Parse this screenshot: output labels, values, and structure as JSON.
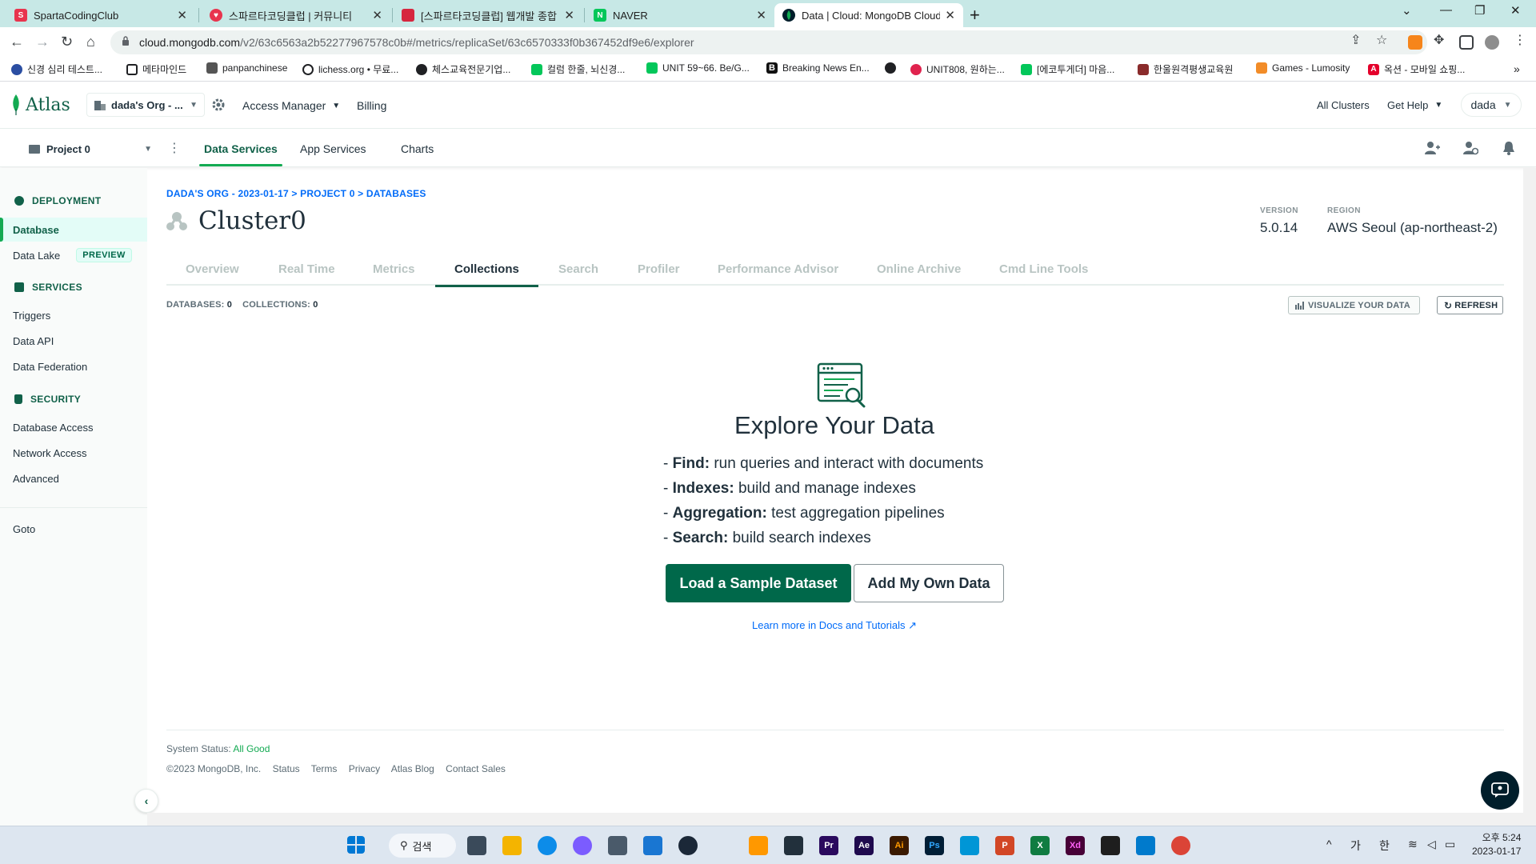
{
  "browser": {
    "tabs": [
      {
        "title": "SpartaCodingClub",
        "active": false
      },
      {
        "title": "스파르타코딩클럽 | 커뮤니티",
        "active": false
      },
      {
        "title": "[스파르타코딩클럽] 웹개발 종합",
        "active": false
      },
      {
        "title": "NAVER",
        "active": false
      },
      {
        "title": "Data | Cloud: MongoDB Cloud",
        "active": true
      }
    ],
    "url_host": "cloud.mongodb.com",
    "url_path": "/v2/63c6563a2b52277967578c0b#/metrics/replicaSet/63c6570333f0b367452df9e6/explorer",
    "bookmarks": [
      "신경 심리 테스트...",
      "메타마인드",
      "panpanchinese",
      "lichess.org • 무료...",
      "체스교육전문기업...",
      "컬럼 한줄, 뇌신경...",
      "UNIT 59~66. Be/G...",
      "Breaking News En...",
      "",
      "UNIT808, 원하는...",
      "[에코투게더] 마음...",
      "한울원격평생교육원",
      "Games - Lumosity",
      "옥션 - 모바일 쇼핑..."
    ]
  },
  "atlas": {
    "logo": "Atlas",
    "org": "dada's Org - ...",
    "access_manager": "Access Manager",
    "billing": "Billing",
    "all_clusters": "All Clusters",
    "get_help": "Get Help",
    "user": "dada",
    "project": "Project 0",
    "subnav": [
      "Data Services",
      "App Services",
      "Charts"
    ]
  },
  "sidebar": {
    "deployment": "DEPLOYMENT",
    "database": "Database",
    "data_lake": "Data Lake",
    "preview": "PREVIEW",
    "services": "SERVICES",
    "triggers": "Triggers",
    "data_api": "Data API",
    "data_federation": "Data Federation",
    "security": "SECURITY",
    "database_access": "Database Access",
    "network_access": "Network Access",
    "advanced": "Advanced",
    "goto": "Goto"
  },
  "main": {
    "breadcrumb": "DADA'S ORG - 2023-01-17 > PROJECT 0 > DATABASES",
    "cluster_name": "Cluster0",
    "version_label": "VERSION",
    "version": "5.0.14",
    "region_label": "REGION",
    "region": "AWS Seoul (ap-northeast-2)",
    "tabs": [
      "Overview",
      "Real Time",
      "Metrics",
      "Collections",
      "Search",
      "Profiler",
      "Performance Advisor",
      "Online Archive",
      "Cmd Line Tools"
    ],
    "databases_label": "DATABASES:",
    "databases_count": "0",
    "collections_label": "COLLECTIONS:",
    "collections_count": "0",
    "visualize_btn": "VISUALIZE YOUR DATA",
    "refresh_btn": "REFRESH",
    "explore_title": "Explore Your Data",
    "features": [
      {
        "name": "Find:",
        "desc": "run queries and interact with documents"
      },
      {
        "name": "Indexes:",
        "desc": "build and manage indexes"
      },
      {
        "name": "Aggregation:",
        "desc": "test aggregation pipelines"
      },
      {
        "name": "Search:",
        "desc": "build search indexes"
      }
    ],
    "load_sample_btn": "Load a Sample Dataset",
    "add_own_btn": "Add My Own Data",
    "docs_link": "Learn more in Docs and Tutorials"
  },
  "footer": {
    "status_label": "System Status:",
    "status_value": "All Good",
    "copyright": "©2023 MongoDB, Inc.",
    "links": [
      "Status",
      "Terms",
      "Privacy",
      "Atlas Blog",
      "Contact Sales"
    ]
  },
  "taskbar": {
    "search": "검색",
    "ime_1": "가",
    "ime_2": "한",
    "time": "오후 5:24",
    "date": "2023-01-17"
  },
  "colors": {
    "accent_green": "#00684a",
    "link_blue": "#016bf8",
    "tab_bar": "#c7e8e6"
  }
}
